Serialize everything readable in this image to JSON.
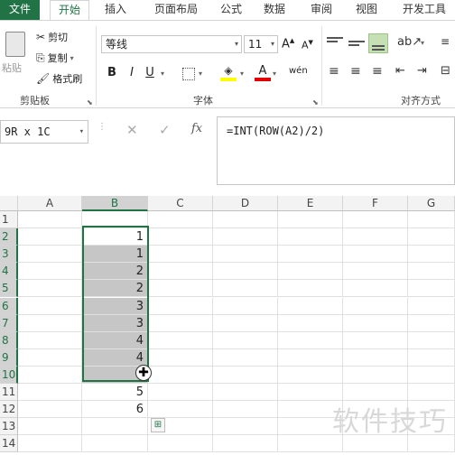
{
  "tabs": [
    "文件",
    "开始",
    "插入",
    "页面布局",
    "公式",
    "数据",
    "审阅",
    "视图",
    "开发工具"
  ],
  "active_tab": "开始",
  "ribbon": {
    "clipboard": {
      "paste": "粘贴",
      "cut": "剪切",
      "copy": "复制",
      "format_painter": "格式刷",
      "label": "剪贴板"
    },
    "font": {
      "name": "等线",
      "size": "11",
      "bold": "B",
      "italic": "I",
      "underline": "U",
      "grow": "A",
      "shrink": "A",
      "phonetic": "wén",
      "label": "字体"
    },
    "alignment": {
      "label": "对齐方式"
    }
  },
  "formula_bar": {
    "name_box": "9R x 1C",
    "formula": "=INT(ROW(A2)/2)",
    "fx": "fx"
  },
  "columns": [
    "A",
    "B",
    "C",
    "D",
    "E",
    "F",
    "G"
  ],
  "rows": [
    "1",
    "2",
    "3",
    "4",
    "5",
    "6",
    "7",
    "8",
    "9",
    "10",
    "11",
    "12",
    "13",
    "14"
  ],
  "cells_b": [
    "",
    "1",
    "1",
    "2",
    "2",
    "3",
    "3",
    "4",
    "4",
    "",
    "5",
    "6",
    "",
    ""
  ],
  "selected_column": "B",
  "watermark": "软件技巧",
  "colors": {
    "accent": "#217346",
    "selection_fill": "#c6c6c6"
  }
}
